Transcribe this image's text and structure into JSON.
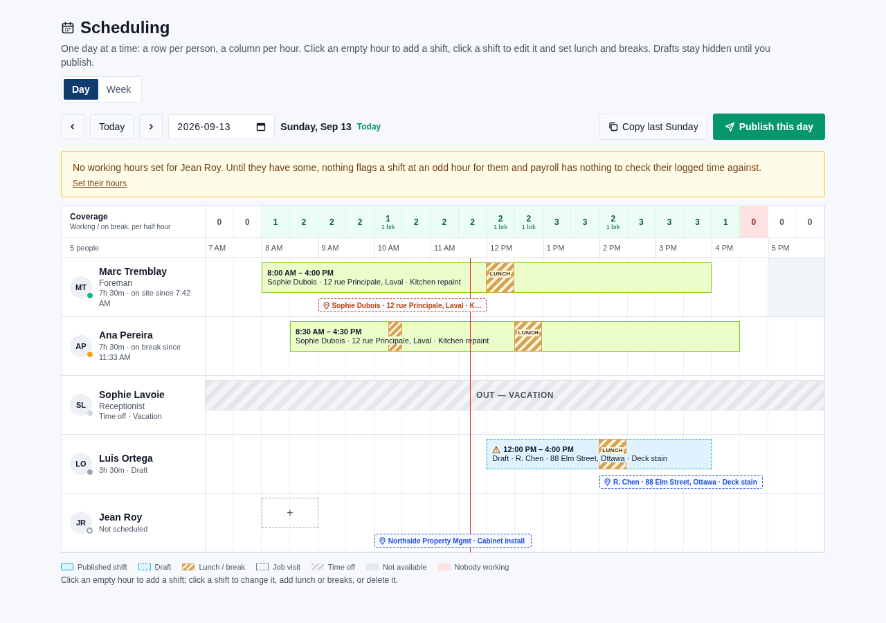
{
  "page": {
    "title": "Scheduling",
    "description": "One day at a time: a row per person, a column per hour. Click an empty hour to add a shift, click a shift to edit it and set lunch and breaks. Drafts stay hidden until you publish."
  },
  "view_toggle": [
    {
      "label": "Day",
      "selected": true
    },
    {
      "label": "Week",
      "selected": false
    }
  ],
  "toolbar": {
    "today_button": "Today",
    "date_value": "2026-09-13",
    "date_label": "Sunday, Sep 13",
    "today_badge": "Today",
    "copy_button": "Copy last Sunday",
    "publish_button": "Publish this day"
  },
  "alert": {
    "message": "No working hours set for Jean Roy. Until they have some, nothing flags a shift at an odd hour for them and payroll has nothing to check their logged time against.",
    "link": "Set their hours"
  },
  "coverage": {
    "title": "Coverage",
    "subtitle": "Working / on break, per half hour",
    "cells": [
      {
        "count": "0",
        "kind": "idle"
      },
      {
        "count": "0",
        "kind": "idle"
      },
      {
        "count": "1",
        "kind": "covered"
      },
      {
        "count": "2",
        "kind": "covered"
      },
      {
        "count": "2",
        "kind": "covered"
      },
      {
        "count": "2",
        "kind": "covered"
      },
      {
        "count": "1",
        "breaks": "1 brk",
        "kind": "covered"
      },
      {
        "count": "2",
        "kind": "covered"
      },
      {
        "count": "2",
        "kind": "covered"
      },
      {
        "count": "2",
        "kind": "covered"
      },
      {
        "count": "2",
        "breaks": "1 brk",
        "kind": "covered"
      },
      {
        "count": "2",
        "breaks": "1 brk",
        "kind": "covered"
      },
      {
        "count": "3",
        "kind": "covered"
      },
      {
        "count": "3",
        "kind": "covered"
      },
      {
        "count": "2",
        "breaks": "1 brk",
        "kind": "covered"
      },
      {
        "count": "3",
        "kind": "covered"
      },
      {
        "count": "3",
        "kind": "covered"
      },
      {
        "count": "3",
        "kind": "covered"
      },
      {
        "count": "1",
        "kind": "covered"
      },
      {
        "count": "0",
        "kind": "nobody"
      },
      {
        "count": "0",
        "kind": "idle"
      },
      {
        "count": "0",
        "kind": "idle"
      }
    ]
  },
  "people_count": "5 people",
  "hours": [
    "7 AM",
    "8 AM",
    "9 AM",
    "10 AM",
    "11 AM",
    "12 PM",
    "1 PM",
    "2 PM",
    "3 PM",
    "4 PM",
    "5 PM"
  ],
  "people": [
    {
      "initials": "MT",
      "name": "Marc Tremblay",
      "role": "Foreman",
      "status": "7h 30m · on site since 7:42 AM",
      "color": "#10b981",
      "dot_hollow": false,
      "shifts": [
        {
          "kind": "published",
          "warning": false,
          "time": "8:00 AM – 4:00 PM",
          "detail": "Sophie Dubois · 12 rue Principale, Laval · Kitchen repaint",
          "breaks": [
            {
              "kind": "lunch",
              "label": "LUNCH"
            }
          ]
        }
      ],
      "visits": [
        {
          "text": "Sophie Dubois · 12 rue Principale, Laval · K…",
          "color": "#c2410c"
        }
      ]
    },
    {
      "initials": "AP",
      "name": "Ana Pereira",
      "status": "7h 30m · on break since 11:33 AM",
      "color": "#f59e0b",
      "dot_hollow": false,
      "shifts": [
        {
          "kind": "published",
          "warning": false,
          "time": "8:30 AM – 4:30 PM",
          "detail": "Sophie Dubois · 12 rue Principale, Laval · Kitchen repaint",
          "breaks": [
            {
              "kind": "break"
            },
            {
              "kind": "lunch",
              "label": "LUNCH"
            }
          ]
        }
      ]
    },
    {
      "initials": "SL",
      "name": "Sophie Lavoie",
      "role": "Receptionist",
      "status": "Time off · Vacation",
      "color": "#d1d5db",
      "dot_hollow": false,
      "time_off": {
        "label": "OUT — VACATION"
      }
    },
    {
      "initials": "LO",
      "name": "Luis Ortega",
      "status": "3h 30m · Draft",
      "color": "#9ca3af",
      "dot_hollow": false,
      "shifts": [
        {
          "kind": "draft",
          "warning": true,
          "time": "12:00 PM – 4:00 PM",
          "detail": "Draft · R. Chen · 88 Elm Street, Ottawa · Deck stain",
          "breaks": [
            {
              "kind": "lunch",
              "label": "LUNCH"
            }
          ]
        }
      ],
      "visits": [
        {
          "text": "R. Chen · 88 Elm Street, Ottawa · Deck stain",
          "color": "#1d4ed8"
        }
      ]
    },
    {
      "initials": "JR",
      "name": "Jean Roy",
      "status": "Not scheduled",
      "color": "#9ca3af",
      "dot_hollow": true,
      "add_slot": {
        "label": "+"
      },
      "visits": [
        {
          "text": "Northside Property Mgmt · Cabinet install",
          "color": "#1d4ed8"
        }
      ]
    }
  ],
  "legend": [
    {
      "kind": "published",
      "label": "Published shift"
    },
    {
      "kind": "draft",
      "label": "Draft"
    },
    {
      "kind": "lunch",
      "label": "Lunch / break"
    },
    {
      "kind": "visit",
      "label": "Job visit"
    },
    {
      "kind": "timeoff",
      "label": "Time off"
    },
    {
      "kind": "unavailable",
      "label": "Not available"
    },
    {
      "kind": "nobody",
      "label": "Nobody working"
    }
  ],
  "footer_hint": "Click an empty hour to add a shift; click a shift to change it, add lunch or breaks, or delete it."
}
